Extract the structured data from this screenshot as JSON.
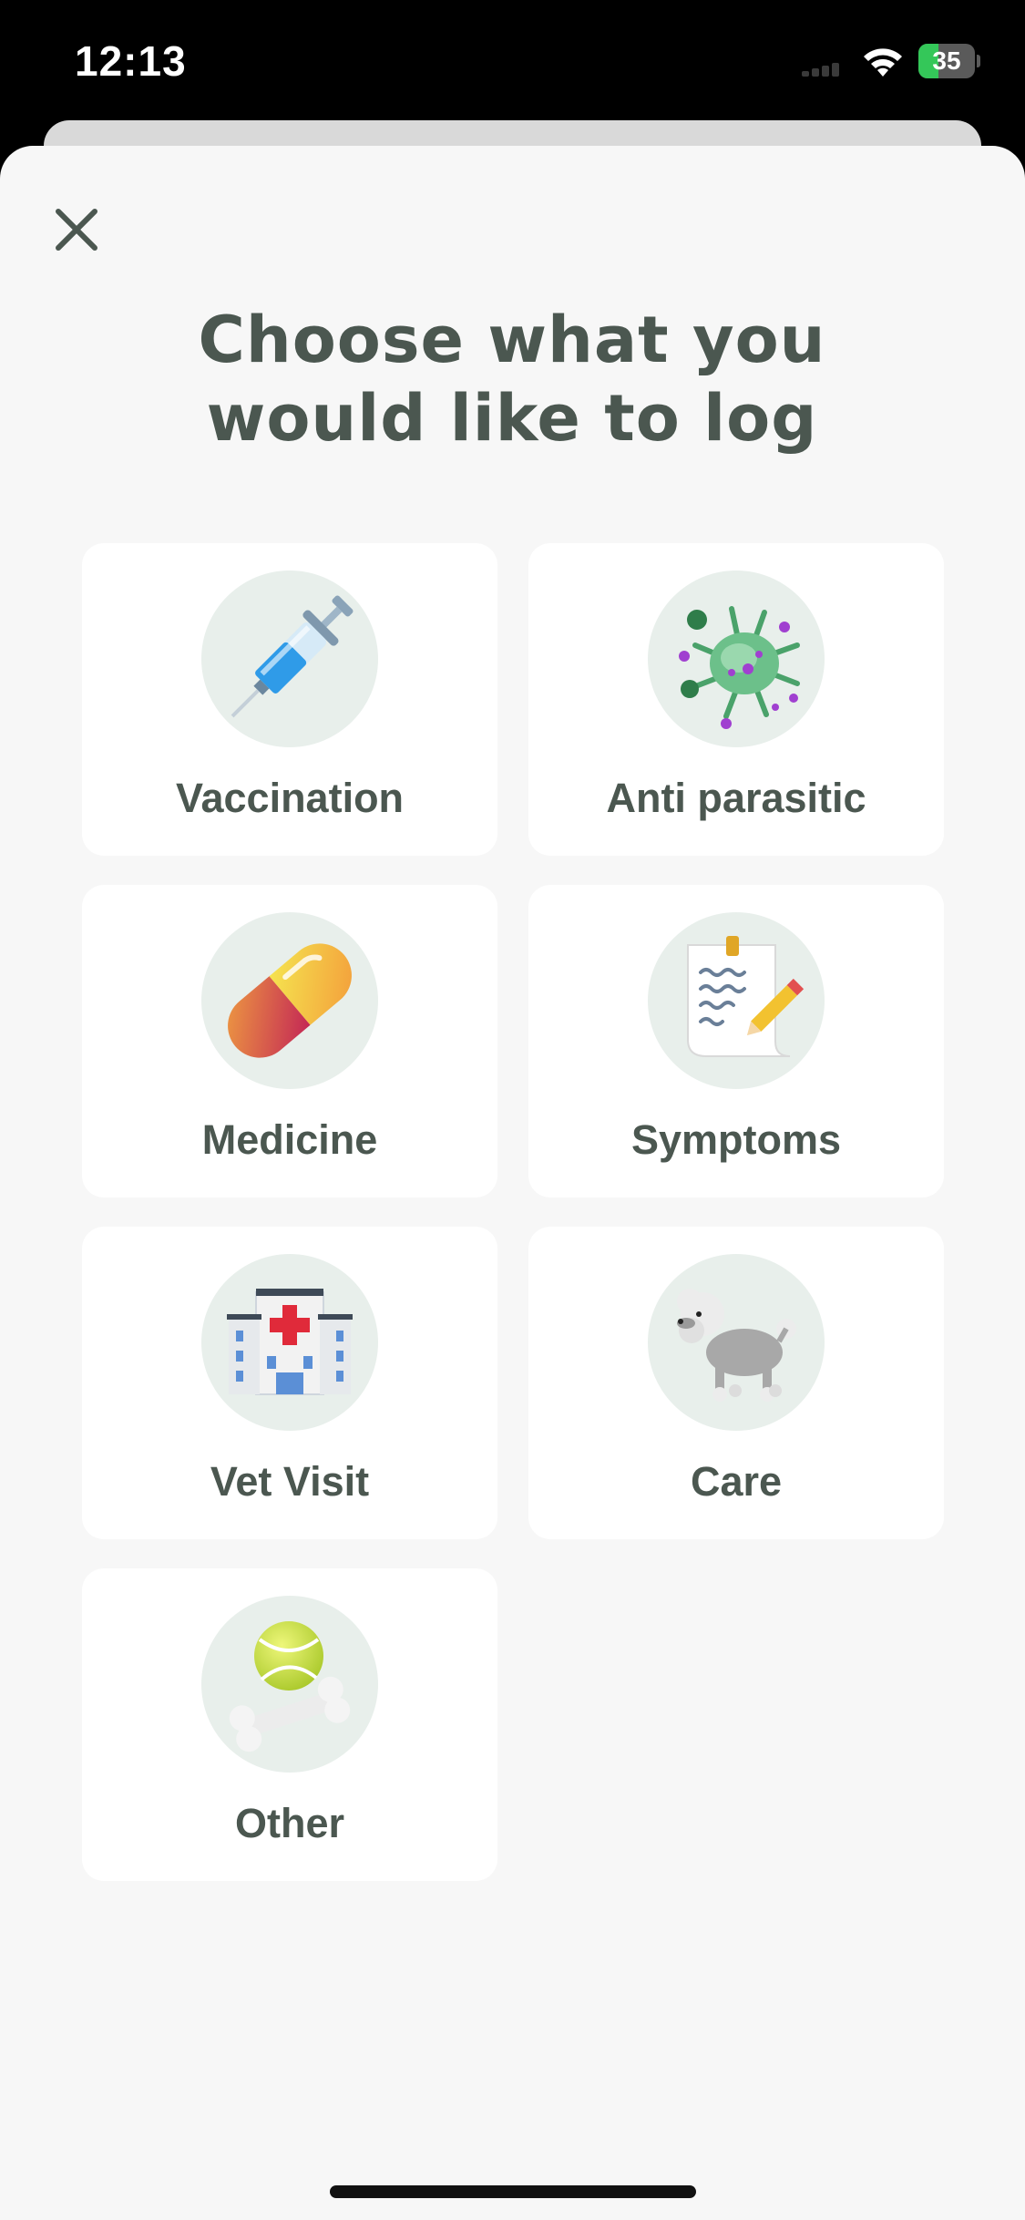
{
  "status_bar": {
    "time": "12:13",
    "battery_level": "35",
    "battery_fraction": 0.35,
    "battery_charging": true,
    "wifi_icon": "wifi-icon",
    "signal_icon": "cellular-signal-icon"
  },
  "sheet": {
    "close_icon": "close-icon",
    "title_line1": "Choose what you",
    "title_line2": "would like to log"
  },
  "options": [
    {
      "label": "Vaccination",
      "icon": "syringe-icon"
    },
    {
      "label": "Anti parasitic",
      "icon": "parasite-icon"
    },
    {
      "label": "Medicine",
      "icon": "pill-capsule-icon"
    },
    {
      "label": "Symptoms",
      "icon": "notepad-pencil-icon"
    },
    {
      "label": "Vet Visit",
      "icon": "hospital-icon"
    },
    {
      "label": "Care",
      "icon": "poodle-icon"
    },
    {
      "label": "Other",
      "icon": "ball-and-bone-icon"
    }
  ],
  "colors": {
    "background": "#f7f7f7",
    "card": "#ffffff",
    "text": "#4b5750",
    "icon_circle": "#e8efeb",
    "battery_green": "#34c759"
  }
}
